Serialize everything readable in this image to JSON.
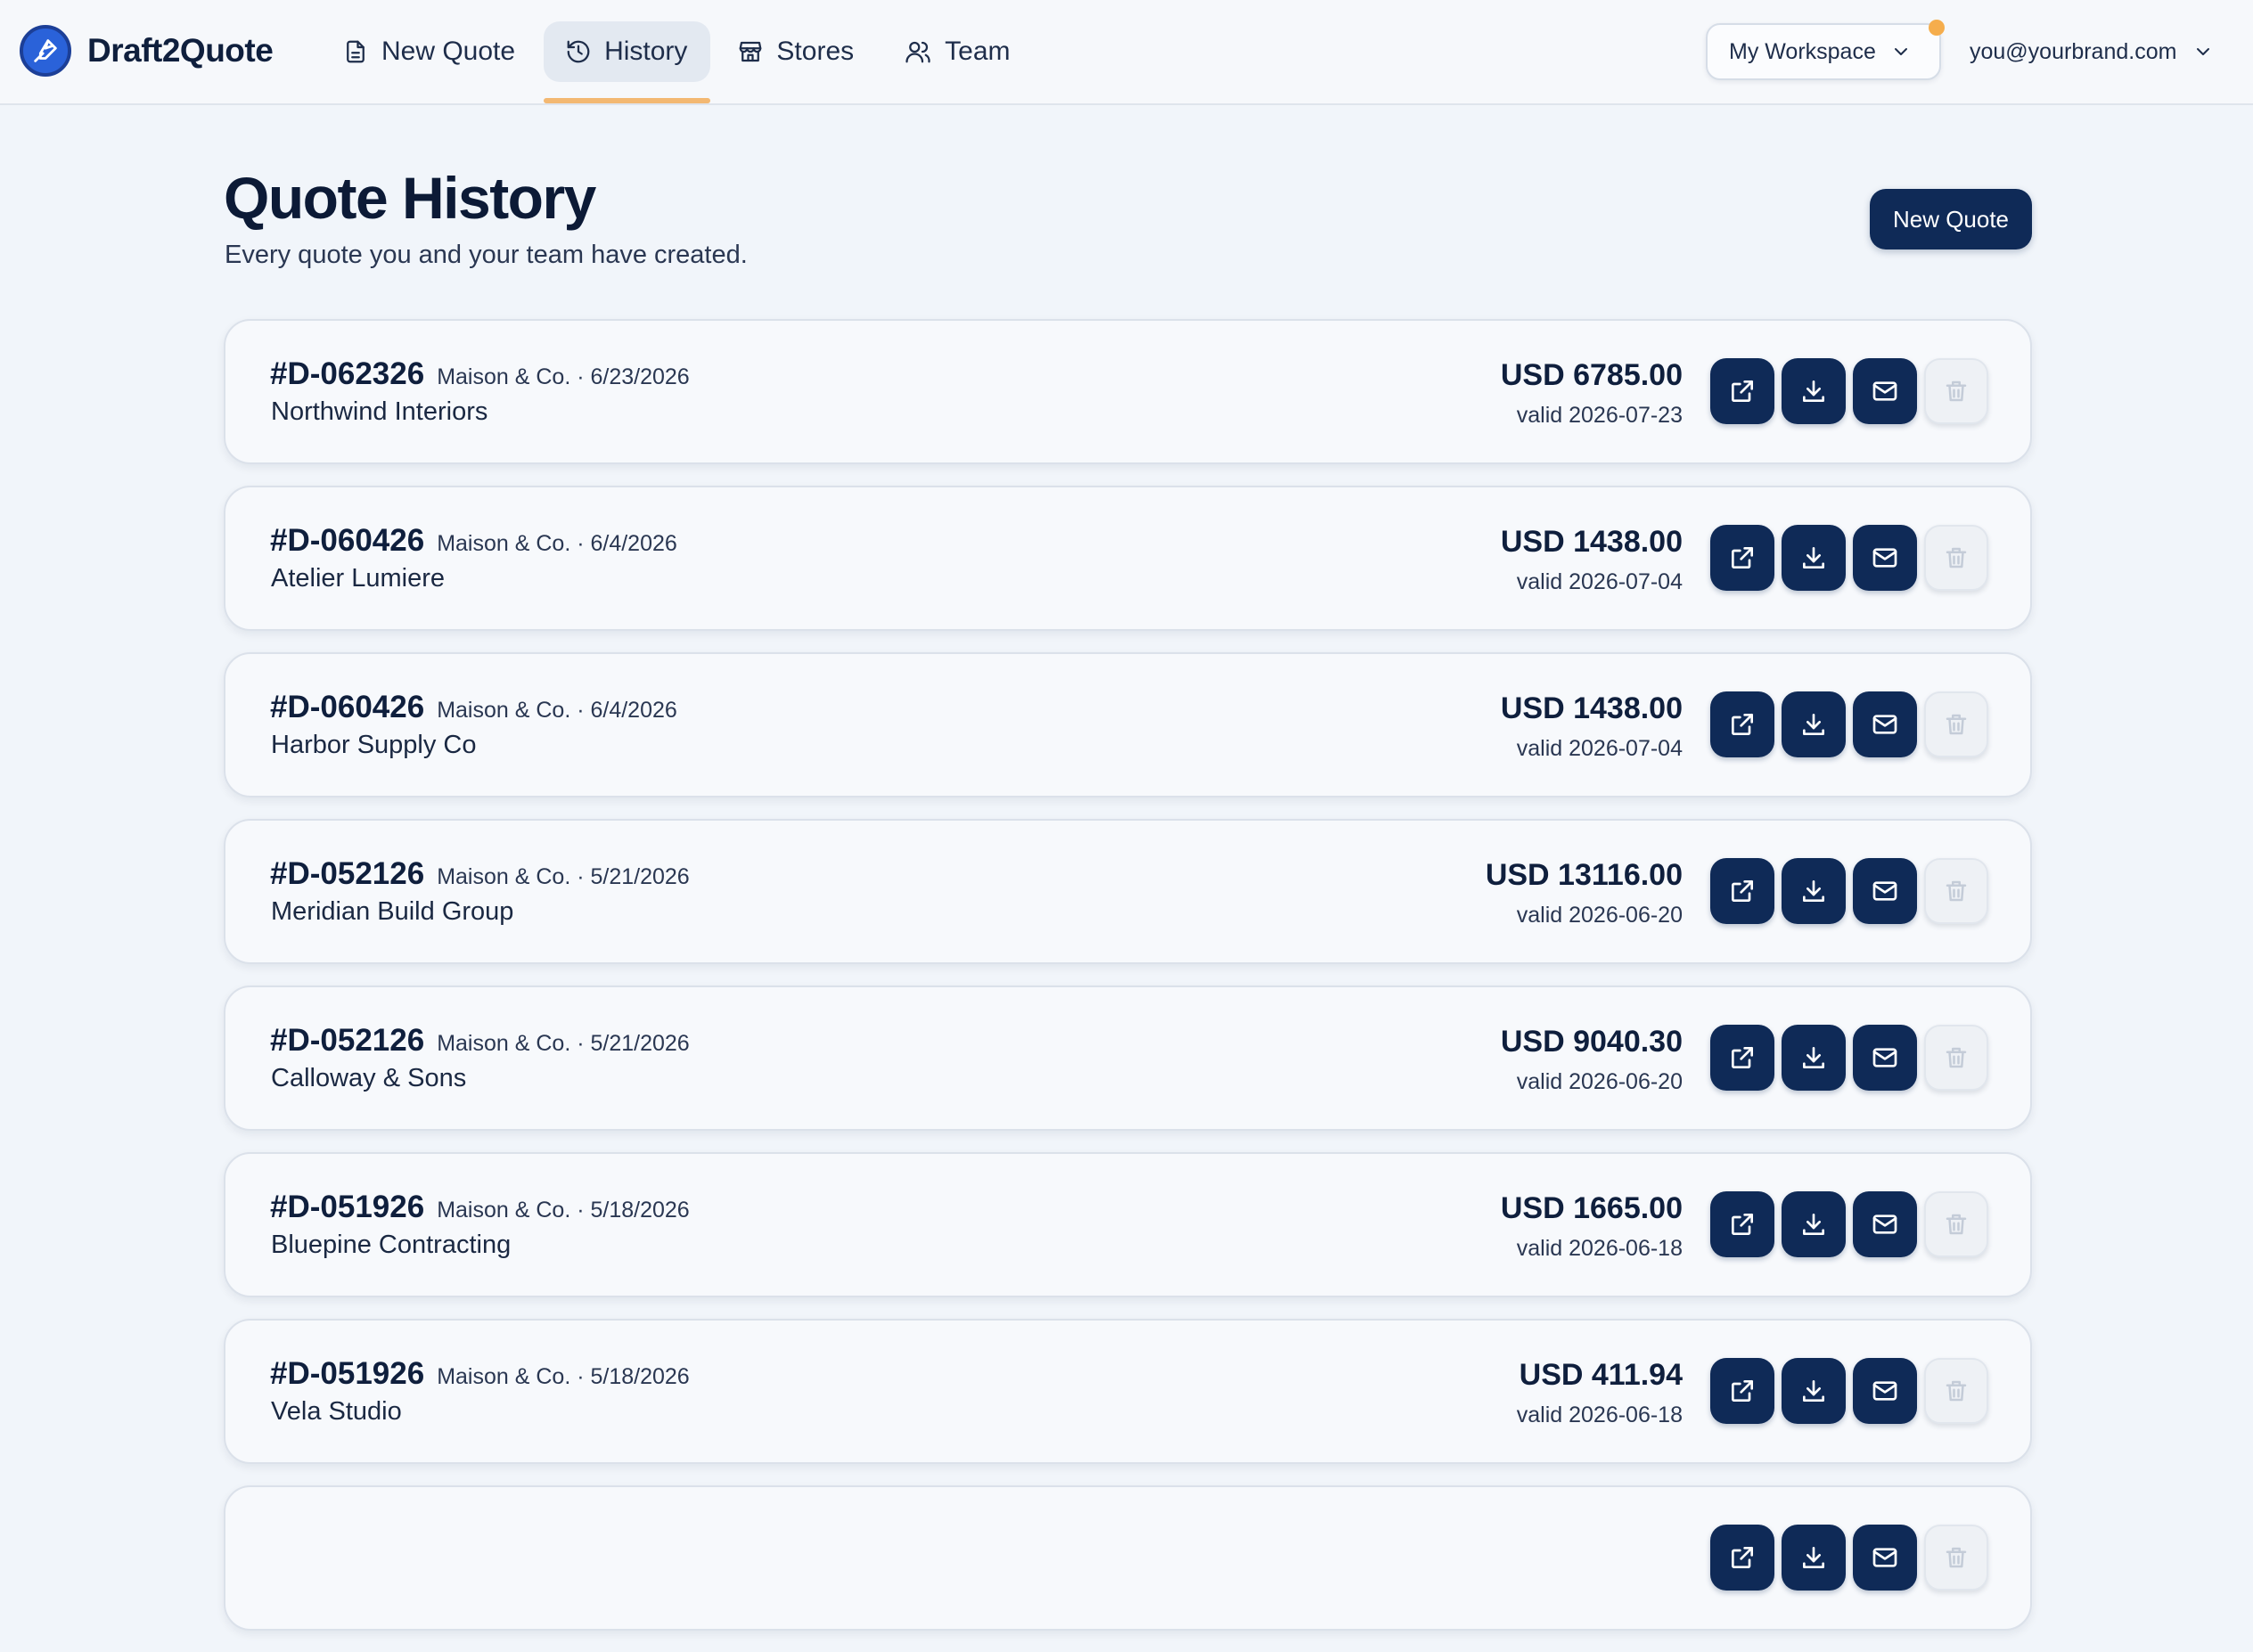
{
  "app": {
    "name": "Draft2Quote"
  },
  "nav": [
    {
      "label": "New Quote",
      "icon": "document-icon",
      "active": false
    },
    {
      "label": "History",
      "icon": "history-icon",
      "active": true
    },
    {
      "label": "Stores",
      "icon": "store-icon",
      "active": false
    },
    {
      "label": "Team",
      "icon": "users-icon",
      "active": false
    }
  ],
  "workspace": {
    "label": "My Workspace",
    "notification_color": "#f5ad4c"
  },
  "account": {
    "email": "you@yourbrand.com"
  },
  "page": {
    "title": "Quote History",
    "subtitle": "Every quote you and your team have created.",
    "new_quote_label": "New Quote"
  },
  "quotes": [
    {
      "id": "#D-062326",
      "meta": "Maison & Co. · 6/23/2026",
      "client": "Northwind Interiors",
      "amount": "USD 6785.00",
      "valid": "valid 2026-07-23"
    },
    {
      "id": "#D-060426",
      "meta": "Maison & Co. · 6/4/2026",
      "client": "Atelier Lumiere",
      "amount": "USD 1438.00",
      "valid": "valid 2026-07-04"
    },
    {
      "id": "#D-060426",
      "meta": "Maison & Co. · 6/4/2026",
      "client": "Harbor Supply Co",
      "amount": "USD 1438.00",
      "valid": "valid 2026-07-04"
    },
    {
      "id": "#D-052126",
      "meta": "Maison & Co. · 5/21/2026",
      "client": "Meridian Build Group",
      "amount": "USD 13116.00",
      "valid": "valid 2026-06-20"
    },
    {
      "id": "#D-052126",
      "meta": "Maison & Co. · 5/21/2026",
      "client": "Calloway & Sons",
      "amount": "USD 9040.30",
      "valid": "valid 2026-06-20"
    },
    {
      "id": "#D-051926",
      "meta": "Maison & Co. · 5/18/2026",
      "client": "Bluepine Contracting",
      "amount": "USD 1665.00",
      "valid": "valid 2026-06-18"
    },
    {
      "id": "#D-051926",
      "meta": "Maison & Co. · 5/18/2026",
      "client": "Vela Studio",
      "amount": "USD 411.94",
      "valid": "valid 2026-06-18"
    },
    {
      "id": "",
      "meta": "",
      "client": "",
      "amount": "",
      "valid": ""
    }
  ],
  "row_actions": [
    {
      "name": "open-external-button",
      "icon": "external-link-icon"
    },
    {
      "name": "download-button",
      "icon": "download-icon"
    },
    {
      "name": "email-button",
      "icon": "mail-icon"
    },
    {
      "name": "delete-button",
      "icon": "trash-icon"
    }
  ],
  "colors": {
    "primary": "#0f2a57",
    "accent": "#f3b872",
    "background": "#f1f5fa"
  }
}
